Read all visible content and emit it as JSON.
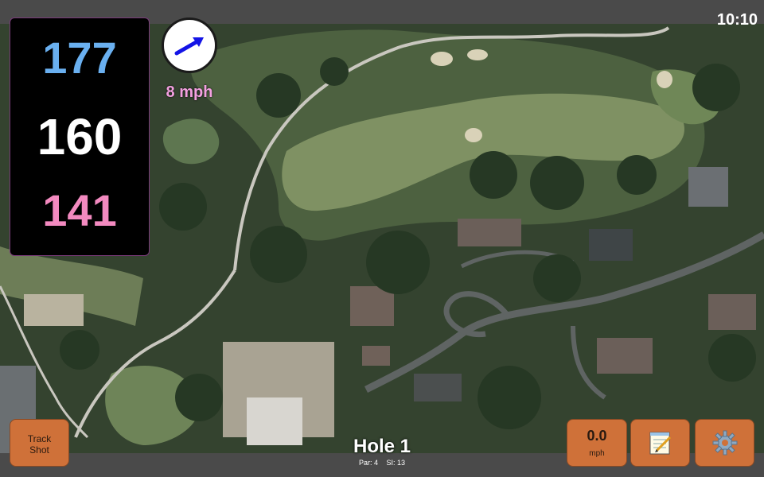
{
  "status": {
    "time": "10:10"
  },
  "distances": {
    "back": "177",
    "middle": "160",
    "front": "141",
    "colors": {
      "back": "#6ab0f0",
      "middle": "#ffffff",
      "front": "#f38ac0"
    }
  },
  "wind": {
    "speed_label": "8 mph",
    "direction_icon": "arrow-icon",
    "label_color": "#f3a0e0",
    "arrow_color": "#1414e6"
  },
  "buttons": {
    "track_shot": [
      "Track",
      "Shot"
    ],
    "wind_value": "0.0",
    "wind_unit": "mph",
    "notes_icon": "notepad-icon",
    "settings_icon": "gear-icon",
    "accent": "#cf7139"
  },
  "hole": {
    "title": "Hole 1",
    "par": "Par: 4",
    "stroke_index": "SI: 13"
  }
}
